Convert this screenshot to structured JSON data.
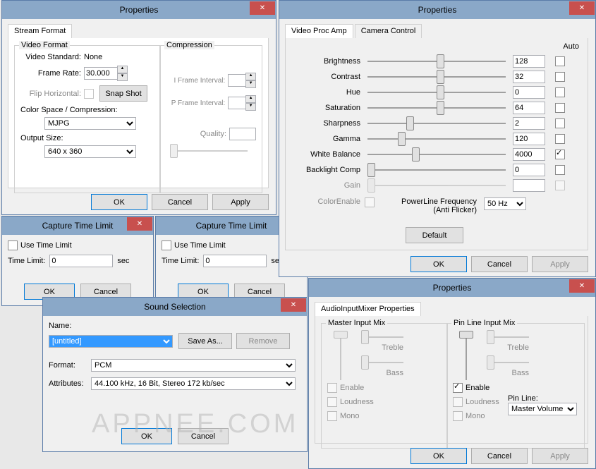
{
  "dlg_props1": {
    "title": "Properties",
    "tab_streamformat": "Stream Format",
    "grp_videoformat": "Video Format",
    "grp_compression": "Compression",
    "lbl_videostd": "Video Standard:",
    "val_videostd": "None",
    "lbl_framerate": "Frame Rate:",
    "val_framerate": "30.000",
    "lbl_fliph": "Flip Horizontal:",
    "btn_snapshot": "Snap Shot",
    "lbl_colorspace": "Color Space / Compression:",
    "val_colorspace": "MJPG",
    "lbl_outputsize": "Output Size:",
    "val_outputsize": "640 x 360",
    "lbl_iframe": "I Frame Interval:",
    "lbl_pframe": "P Frame Interval:",
    "lbl_quality": "Quality:",
    "btn_ok": "OK",
    "btn_cancel": "Cancel",
    "btn_apply": "Apply"
  },
  "dlg_ctl1": {
    "title": "Capture Time Limit",
    "chk_usetl": "Use Time Limit",
    "lbl_tl": "Time Limit:",
    "val_tl": "0",
    "lbl_sec": "sec",
    "btn_ok": "OK",
    "btn_cancel": "Cancel"
  },
  "dlg_ctl2": {
    "title": "Capture Time Limit",
    "chk_usetl": "Use Time Limit",
    "lbl_tl": "Time Limit:",
    "val_tl": "0",
    "lbl_sec": "sec",
    "btn_ok": "OK",
    "btn_cancel": "Cancel"
  },
  "dlg_sound": {
    "title": "Sound Selection",
    "lbl_name": "Name:",
    "val_name": "[untitled]",
    "btn_saveas": "Save As...",
    "btn_remove": "Remove",
    "lbl_format": "Format:",
    "val_format": "PCM",
    "lbl_attr": "Attributes:",
    "val_attr": "44.100 kHz, 16 Bit, Stereo                    172 kb/sec",
    "btn_ok": "OK",
    "btn_cancel": "Cancel"
  },
  "dlg_props2": {
    "title": "Properties",
    "tab_vpa": "Video Proc Amp",
    "tab_cc": "Camera Control",
    "lbl_auto": "Auto",
    "sliders": [
      {
        "label": "Brightness",
        "value": "128",
        "pos": 50,
        "auto": false,
        "enabled": true
      },
      {
        "label": "Contrast",
        "value": "32",
        "pos": 50,
        "auto": false,
        "enabled": true
      },
      {
        "label": "Hue",
        "value": "0",
        "pos": 50,
        "auto": false,
        "enabled": true
      },
      {
        "label": "Saturation",
        "value": "64",
        "pos": 50,
        "auto": false,
        "enabled": true
      },
      {
        "label": "Sharpness",
        "value": "2",
        "pos": 28,
        "auto": false,
        "enabled": true
      },
      {
        "label": "Gamma",
        "value": "120",
        "pos": 22,
        "auto": false,
        "enabled": true
      },
      {
        "label": "White Balance",
        "value": "4000",
        "pos": 32,
        "auto": true,
        "enabled": true
      },
      {
        "label": "Backlight Comp",
        "value": "0",
        "pos": 0,
        "auto": false,
        "enabled": true
      },
      {
        "label": "Gain",
        "value": "",
        "pos": 0,
        "auto": false,
        "enabled": false
      }
    ],
    "lbl_colorenable": "ColorEnable",
    "lbl_powerline1": "PowerLine Frequency",
    "lbl_powerline2": "(Anti Flicker)",
    "val_powerline": "50 Hz",
    "btn_default": "Default",
    "btn_ok": "OK",
    "btn_cancel": "Cancel",
    "btn_apply": "Apply"
  },
  "dlg_props3": {
    "title": "Properties",
    "tab_aim": "AudioInputMixer Properties",
    "grp_master": "Master Input Mix",
    "grp_pinline": "Pin Line Input Mix",
    "lbl_treble": "Treble",
    "lbl_bass": "Bass",
    "chk_enable": "Enable",
    "chk_loudness": "Loudness",
    "chk_mono": "Mono",
    "lbl_pinline": "Pin Line:",
    "val_pinline": "Master Volume",
    "btn_ok": "OK",
    "btn_cancel": "Cancel",
    "btn_apply": "Apply"
  },
  "watermark": "APPNEE.COM"
}
